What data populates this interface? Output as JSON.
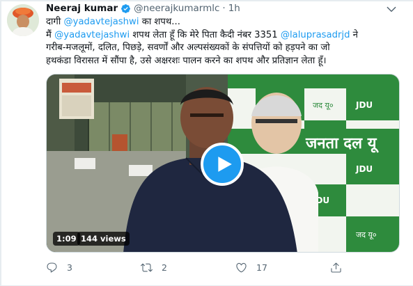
{
  "author": {
    "name": "Neeraj kumar",
    "handle": "@neerajkumarmlc",
    "separator": "·",
    "time": "1h"
  },
  "tweet": {
    "line1_prefix": "दागी ",
    "line1_mention": "@yadavtejashwi",
    "line1_suffix": " का शपथ...",
    "line2_prefix": "मैं ",
    "line2_mention1": "@yadavtejashwi",
    "line2_middle": " शपथ लेता हूँ कि मेरे पिता कैदी नंबर 3351 ",
    "line2_mention2": "@laluprasadrjd",
    "line2_suffix": " ने",
    "line3": "गरीब-मजलूमों, दलित, पिछड़े, सवर्णों और अल्पसंख्यकों के संपत्तियों को हड़पने का जो",
    "line4": "हथकंडा विरासत में सौंपा है, उसे अक्षरशः पालन करने का शपथ और प्रतिज्ञान लेता हूँ।"
  },
  "video": {
    "duration": "1:09",
    "views": "144 views",
    "poster_texts": {
      "party_hindi_small": "जद यू०",
      "party_english": "JDU",
      "party_hindi_banner": "जनता दल यू"
    }
  },
  "actions": {
    "replies": "3",
    "retweets": "2",
    "likes": "17"
  },
  "colors": {
    "accent": "#1d9bf0",
    "text": "#0f1419",
    "secondary": "#536471",
    "jdu_green": "#2e8b3d"
  },
  "icons": {
    "verified": "verified-badge-icon",
    "caret": "chevron-down-icon",
    "play": "play-icon",
    "reply": "reply-icon",
    "retweet": "retweet-icon",
    "like": "heart-icon",
    "share": "share-icon"
  }
}
